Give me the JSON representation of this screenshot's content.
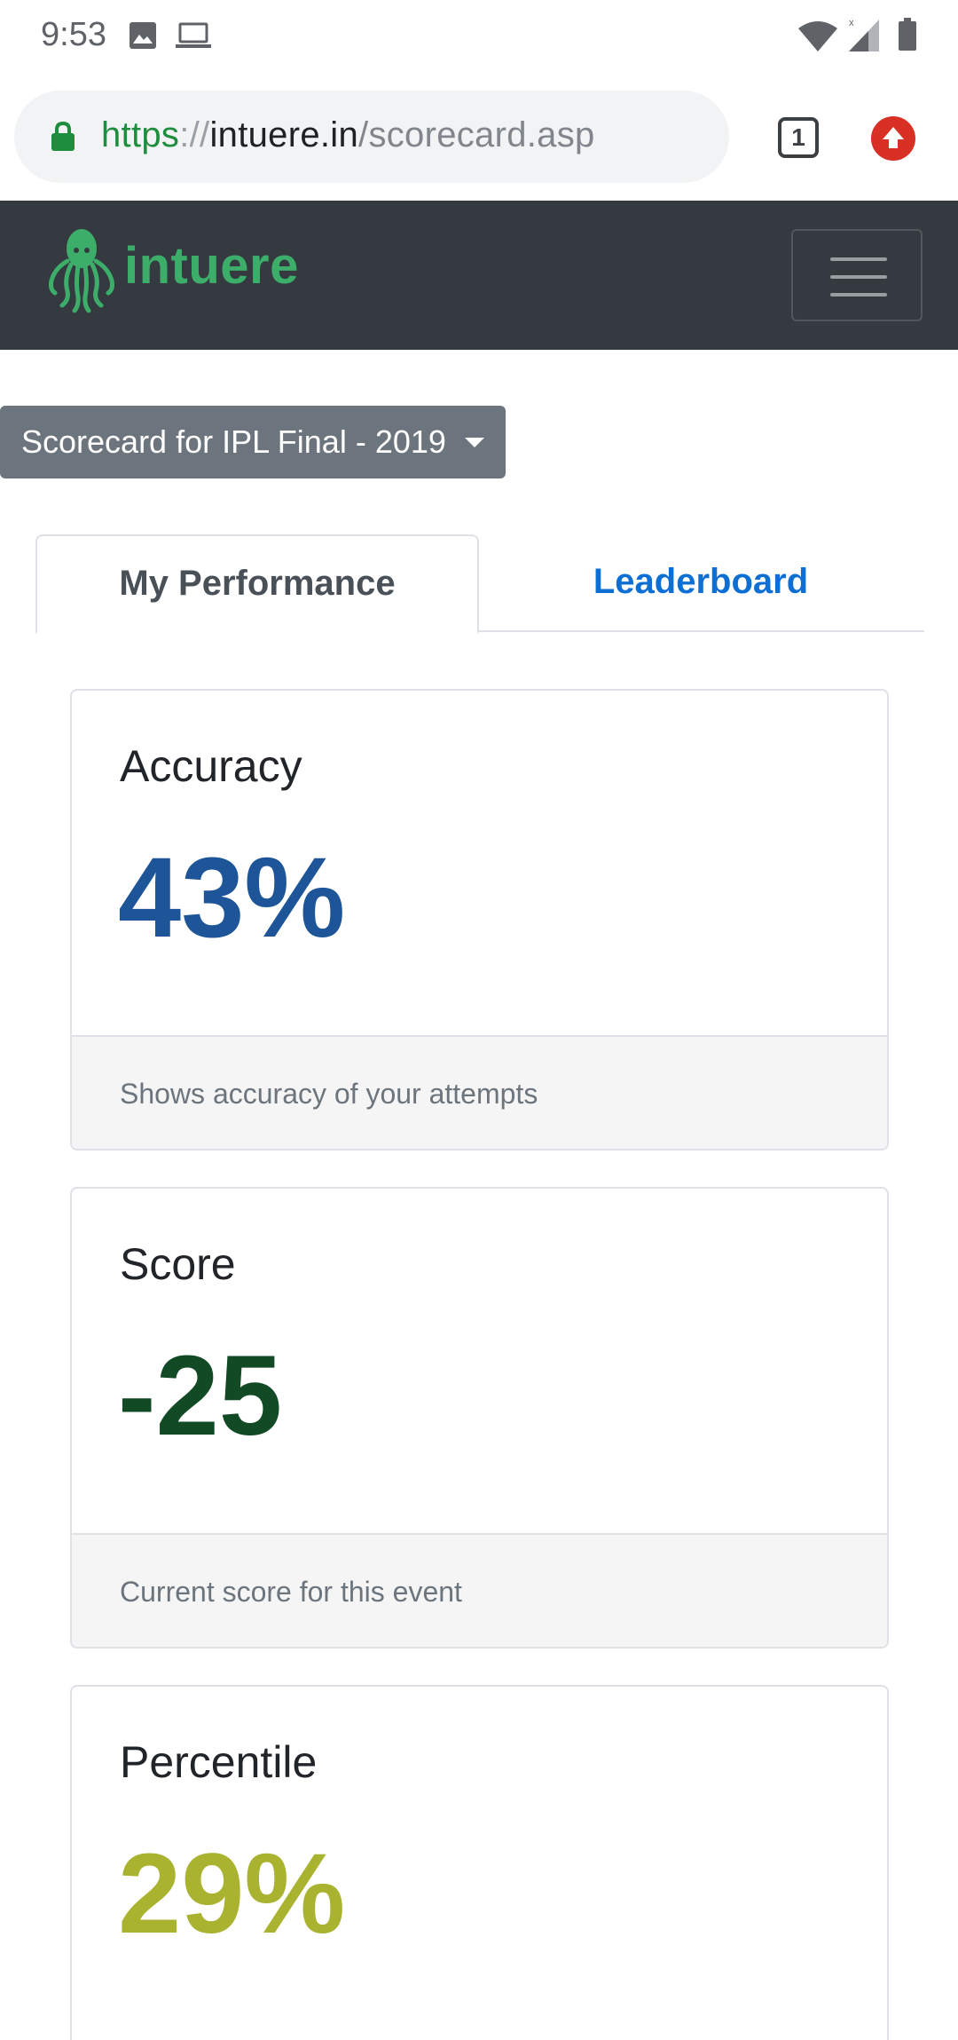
{
  "status_bar": {
    "time": "9:53",
    "icons": [
      "gallery-icon",
      "laptop-icon",
      "wifi-icon",
      "signal-icon",
      "battery-icon"
    ]
  },
  "browser": {
    "url_scheme": "https",
    "url_separator": "://",
    "url_host": "intuere.in",
    "url_path": "/scorecard.asp",
    "tab_count": "1",
    "colors": {
      "secure": "#1e8e3e",
      "update": "#d93025"
    }
  },
  "navbar": {
    "brand_name": "intuere",
    "colors": {
      "background": "#343a40",
      "brand": "#3cae6a"
    }
  },
  "dropdown": {
    "label": "Scorecard for IPL Final - 2019"
  },
  "tabs": [
    {
      "label": "My Performance",
      "active": true
    },
    {
      "label": "Leaderboard",
      "active": false
    }
  ],
  "cards": {
    "accuracy": {
      "title": "Accuracy",
      "value": "43%",
      "footer": "Shows accuracy of your attempts",
      "color": "#1d5598"
    },
    "score": {
      "title": "Score",
      "value": "-25",
      "footer": "Current score for this event",
      "color": "#114a25"
    },
    "percentile": {
      "title": "Percentile",
      "value": "29%",
      "color": "#a9b32f"
    }
  }
}
